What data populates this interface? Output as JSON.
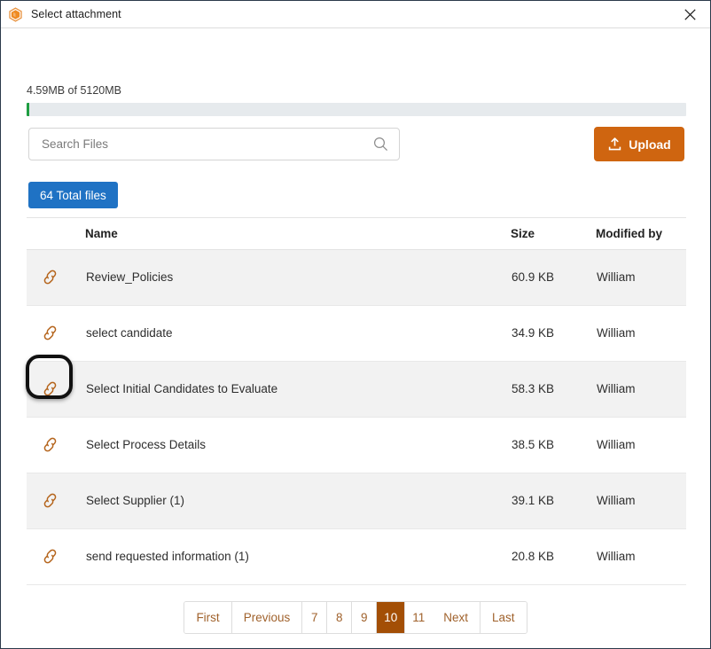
{
  "window": {
    "title": "Select attachment",
    "app_icon": "package-icon",
    "close_icon": "close-icon"
  },
  "quota": {
    "label": "4.59MB of 5120MB",
    "used_mb": 4.59,
    "total_mb": 5120,
    "percent": 0.09,
    "fill_color": "#1f9d42",
    "track_color": "#e6eaed"
  },
  "search": {
    "value": "",
    "placeholder": "Search Files",
    "icon": "search-icon"
  },
  "upload": {
    "label": "Upload",
    "icon": "upload-icon",
    "color": "#cf6510"
  },
  "total_files": {
    "label": "64 Total files",
    "count": 64,
    "color": "#1f72c4"
  },
  "table": {
    "columns": [
      "",
      "Name",
      "Size",
      "Modified by"
    ],
    "rows": [
      {
        "icon": "link-icon",
        "name": "Review_Policies",
        "size": "60.9 KB",
        "modified_by": "William"
      },
      {
        "icon": "link-icon",
        "name": "select candidate",
        "size": "34.9 KB",
        "modified_by": "William"
      },
      {
        "icon": "link-icon",
        "name": "Select Initial Candidates to Evaluate",
        "size": "58.3 KB",
        "modified_by": "William"
      },
      {
        "icon": "link-icon",
        "name": "Select Process Details",
        "size": "38.5 KB",
        "modified_by": "William"
      },
      {
        "icon": "link-icon",
        "name": "Select Supplier (1)",
        "size": "39.1 KB",
        "modified_by": "William"
      },
      {
        "icon": "link-icon",
        "name": "send requested information (1)",
        "size": "20.8 KB",
        "modified_by": "William"
      }
    ],
    "annotated_row_index": 2,
    "link_icon_color": "#b5651d"
  },
  "pagination": {
    "first": "First",
    "previous": "Previous",
    "pages": [
      "7",
      "8",
      "9",
      "10",
      "11"
    ],
    "active_page": "10",
    "next": "Next",
    "last": "Last",
    "active_color": "#a34f06",
    "link_color": "#a0622c"
  }
}
